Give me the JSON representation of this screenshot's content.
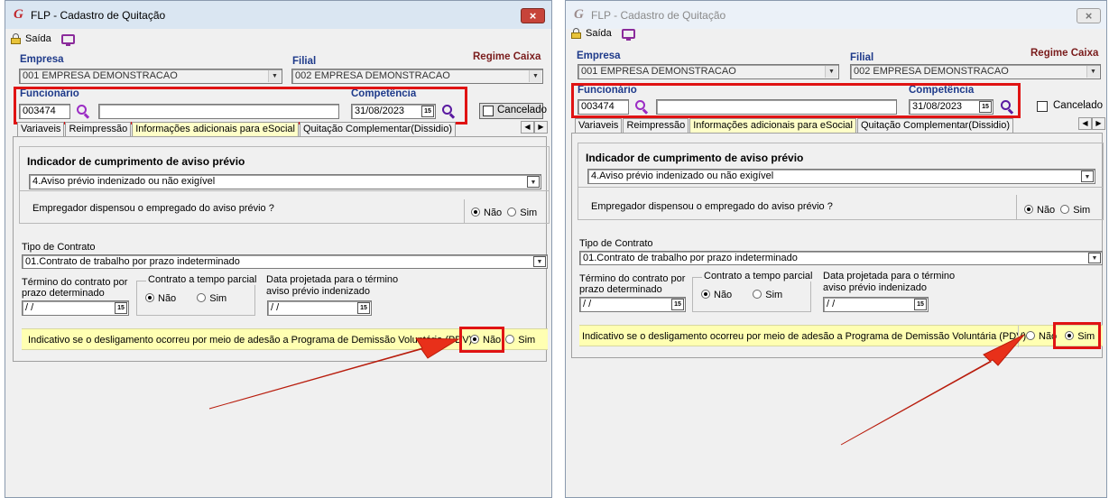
{
  "left": {
    "title": "FLP - Cadastro de Quitação",
    "close_icon": "×",
    "toolbar": {
      "exit_label": "Saída",
      "icons": [
        "lock-icon",
        "monitor-icon"
      ]
    },
    "empresa": {
      "label": "Empresa",
      "value": "001 EMPRESA DEMONSTRACAO"
    },
    "filial": {
      "label": "Filial",
      "value": "002 EMPRESA DEMONSTRACAO"
    },
    "regime": "Regime Caixa",
    "funcionario": {
      "label": "Funcionário",
      "code": "003474",
      "name": ""
    },
    "competencia": {
      "label": "Competência",
      "value": "31/08/2023"
    },
    "cancelado": {
      "label": "Cancelado",
      "checked": false
    },
    "tabs": [
      "Variaveis",
      "Reimpressão",
      "Informações adicionais para eSocial",
      "Quitação Complementar(Dissidio)"
    ],
    "active_tab": 2,
    "aviso": {
      "title": "Indicador de cumprimento de aviso prévio",
      "value": "4.Aviso prévio indenizado ou não exigível"
    },
    "empregador": {
      "question": "Empregador dispensou o empregado do aviso prévio ?",
      "opt_no": "Não",
      "opt_yes": "Sim",
      "selected": "Não"
    },
    "tipo_contrato": {
      "label": "Tipo de Contrato",
      "value": "01.Contrato de trabalho por prazo indeterminado"
    },
    "termino": {
      "label_line1": "Término do contrato por",
      "label_line2": "prazo determinado",
      "value": " /  /"
    },
    "parcial": {
      "label": "Contrato a tempo parcial",
      "opt_no": "Não",
      "opt_yes": "Sim",
      "selected": "Não"
    },
    "data_projetada": {
      "label_line1": "Data projetada para o término",
      "label_line2": "aviso prévio indenizado",
      "value": " /  /"
    },
    "pdv": {
      "question": "Indicativo se o desligamento ocorreu por meio de adesão a Programa de Demissão Voluntária (PDV)",
      "opt_no": "Não",
      "opt_yes": "Sim",
      "selected": "Não"
    },
    "calendar_icon_text": "15"
  },
  "right": {
    "title": "FLP - Cadastro de Quitação",
    "close_icon": "×",
    "toolbar": {
      "exit_label": "Saída",
      "icons": [
        "lock-icon",
        "monitor-icon"
      ]
    },
    "empresa": {
      "label": "Empresa",
      "value": "001 EMPRESA DEMONSTRACAO"
    },
    "filial": {
      "label": "Filial",
      "value": "002 EMPRESA DEMONSTRACAO"
    },
    "regime": "Regime Caixa",
    "funcionario": {
      "label": "Funcionário",
      "code": "003474",
      "name": ""
    },
    "competencia": {
      "label": "Competência",
      "value": "31/08/2023"
    },
    "cancelado": {
      "label": "Cancelado",
      "checked": false
    },
    "tabs": [
      "Variaveis",
      "Reimpressão",
      "Informações adicionais para eSocial",
      "Quitação Complementar(Dissidio)"
    ],
    "active_tab": 2,
    "aviso": {
      "title": "Indicador de cumprimento de aviso prévio",
      "value": "4.Aviso prévio indenizado ou não exigível"
    },
    "empregador": {
      "question": "Empregador dispensou o empregado do aviso prévio ?",
      "opt_no": "Não",
      "opt_yes": "Sim",
      "selected": "Não"
    },
    "tipo_contrato": {
      "label": "Tipo de Contrato",
      "value": "01.Contrato de trabalho por prazo indeterminado"
    },
    "termino": {
      "label_line1": "Término do contrato por",
      "label_line2": "prazo determinado",
      "value": " /  /"
    },
    "parcial": {
      "label": "Contrato a tempo parcial",
      "opt_no": "Não",
      "opt_yes": "Sim",
      "selected": "Não"
    },
    "data_projetada": {
      "label_line1": "Data projetada para o término",
      "label_line2": "aviso prévio indenizado",
      "value": " /  /"
    },
    "pdv": {
      "question": "Indicativo se o desligamento ocorreu por meio de adesão a Programa de Demissão Voluntária (PDV)",
      "opt_no": "Não",
      "opt_yes": "Sim",
      "selected": "Sim"
    },
    "calendar_icon_text": "15"
  },
  "colors": {
    "highlight": "#e01313",
    "arrow": "#e8301a",
    "active_tab": "#ffffc8",
    "pdv_row": "#ffffb2"
  }
}
